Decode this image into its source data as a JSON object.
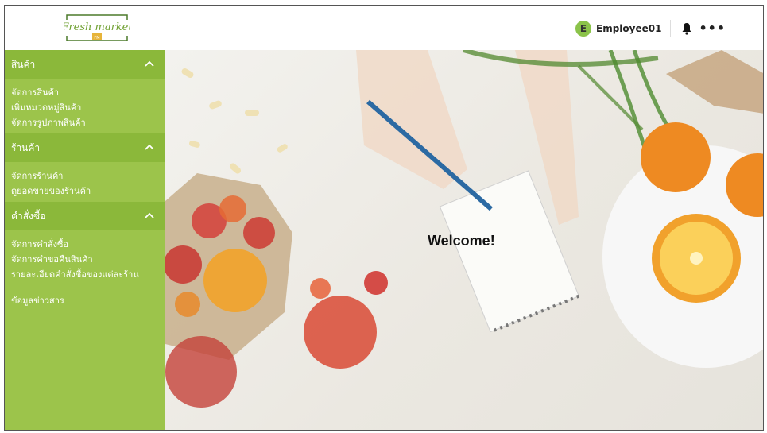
{
  "header": {
    "logo_text": "Fresh market",
    "logo_sub": "FM",
    "user": {
      "initial": "E",
      "name": "Employee01"
    },
    "more_label": "•••"
  },
  "sidebar": {
    "sections": [
      {
        "title": "สินค้า",
        "items": [
          "จัดการสินค้า",
          "เพิ่มหมวดหมู่สินค้า",
          "จัดการรูปภาพสินค้า"
        ]
      },
      {
        "title": "ร้านค้า",
        "items": [
          "จัดการร้านค้า",
          "ดูยอดขายของร้านค้า"
        ]
      },
      {
        "title": "คำสั่งซื้อ",
        "items": [
          "จัดการคำสั่งซื้อ",
          "จัดการคำขอคืนสินค้า",
          "รายละเอียดคำสั่งซื้อของแต่ละร้าน"
        ]
      }
    ],
    "news": "ข้อมูลข่าวสาร"
  },
  "main": {
    "welcome": "Welcome!"
  },
  "colors": {
    "sidebar": "#9cc44b",
    "sidebar_header": "#8bb83a",
    "avatar": "#8bc34a"
  }
}
